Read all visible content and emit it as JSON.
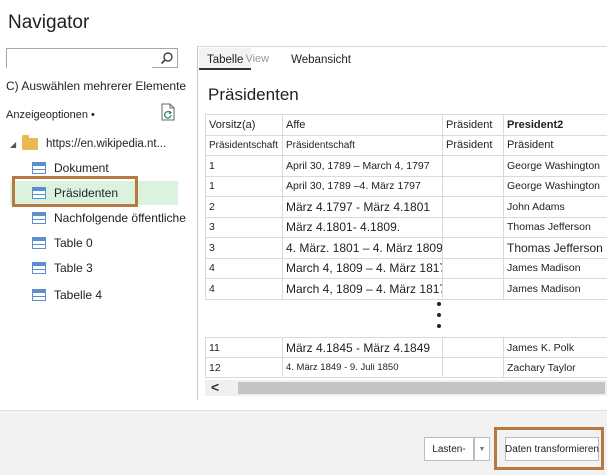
{
  "window": {
    "title": "Navigator"
  },
  "search": {
    "value": "",
    "icon": "search-icon"
  },
  "sidebar": {
    "select_multiple": "C) Auswählen mehrerer Elemente",
    "display_options": "Anzeigeoptionen •",
    "root": "https://en.wikipedia.nt...",
    "items": [
      {
        "label": "Dokument",
        "selected": false
      },
      {
        "label": "Präsidenten",
        "selected": true
      },
      {
        "label": "Nachfolgende öffentliche",
        "selected": false
      },
      {
        "label": "Table 0",
        "selected": false
      },
      {
        "label": "Table 3",
        "selected": false
      },
      {
        "label": "Tabelle 4",
        "selected": false
      }
    ]
  },
  "tabs": {
    "table": "Tabelle",
    "ghost": "View",
    "web": "Webansicht"
  },
  "table": {
    "title": "Präsidenten",
    "headers": [
      "Vorsitz(a)",
      "Affe",
      "Präsident",
      "President2"
    ],
    "subheaders": [
      "Präsidentschaft",
      "Präsidentschaft",
      "Präsident",
      "Präsident"
    ],
    "rows": [
      [
        "1",
        "April 30, 1789 – March 4, 1797",
        "",
        "George Washington"
      ],
      [
        "1",
        "April 30, 1789 –4. März 1797",
        "",
        "George Washington"
      ],
      [
        "2",
        "März 4.1797 -   März 4.1801",
        "",
        "John Adams"
      ],
      [
        "3",
        "März 4.1801-        4.1809.",
        "",
        "Thomas Jefferson"
      ],
      [
        "3",
        "4. März.  1801 –    4. März 1809",
        "",
        "Thomas Jefferson"
      ],
      [
        "4",
        "March 4, 1809 –  4. März 1817",
        "",
        "James Madison"
      ],
      [
        "4",
        "March 4, 1809 –  4. März 1817",
        "",
        "James Madison"
      ]
    ],
    "tail_rows": [
      [
        "11",
        "März 4.1845 -   März 4.1849",
        "",
        "James K. Polk"
      ],
      [
        "12",
        "4. März 1849 - 9. Juli 1850",
        "",
        "Zachary  Taylor"
      ]
    ]
  },
  "footer": {
    "load": "Lasten-",
    "transform": "Daten transformieren"
  },
  "colors": {
    "highlight": "#b7793f",
    "selected_bg": "#dbf2df",
    "table_icon": "#5b8fd0"
  }
}
